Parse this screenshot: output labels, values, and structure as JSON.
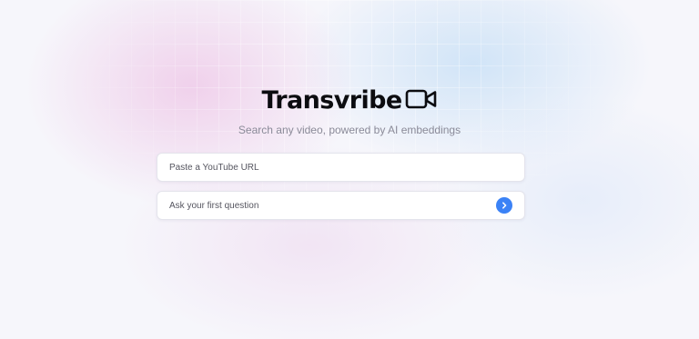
{
  "brand": {
    "name": "Transvribe",
    "icon": "video-camera-icon"
  },
  "tagline": "Search any video, powered by AI embeddings",
  "url_input": {
    "placeholder": "Paste a YouTube URL",
    "value": ""
  },
  "question_input": {
    "placeholder": "Ask your first question",
    "value": ""
  },
  "submit": {
    "icon": "chevron-right-icon",
    "color": "#3b82f6"
  },
  "colors": {
    "accent": "#3b82f6",
    "brand_text": "#0c0c10",
    "tagline_text": "#8a8a98"
  }
}
